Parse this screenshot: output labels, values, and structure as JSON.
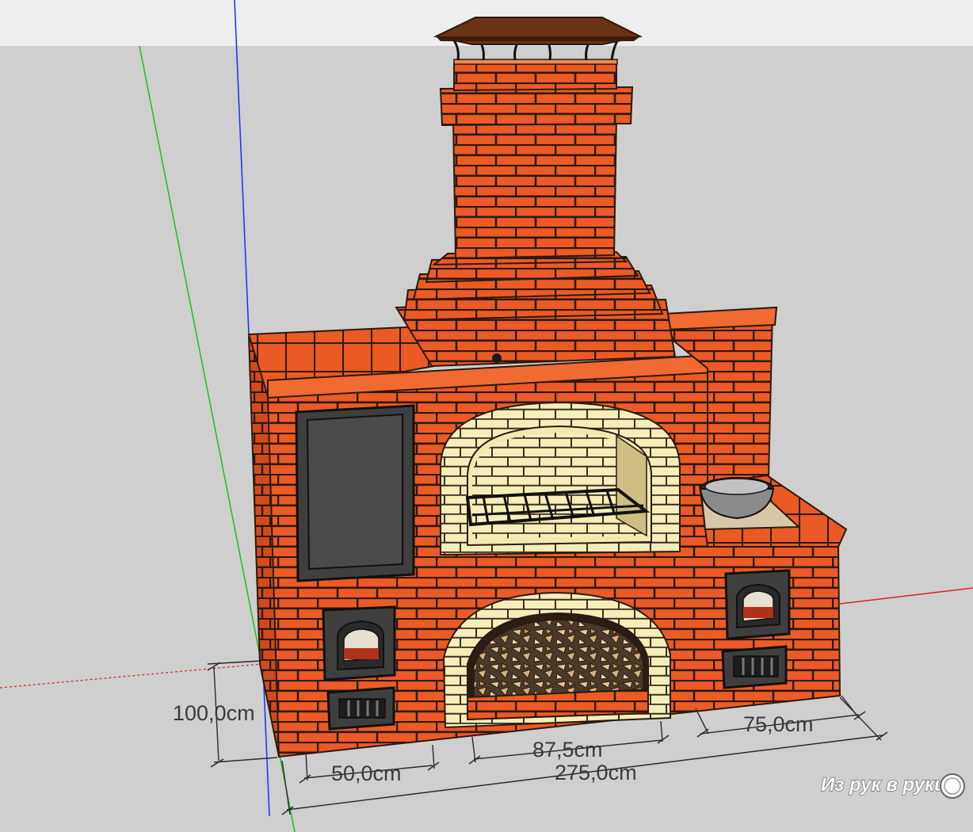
{
  "dimensions": {
    "height": "100,0cm",
    "left_section": "50,0cm",
    "middle_section": "87,5cm",
    "right_section": "75,0cm",
    "total_width": "275,0cm"
  },
  "watermark": {
    "text": "Из рук в руки"
  },
  "colors": {
    "sky": "#eeeeee",
    "ground": "#cfcfcf",
    "brick": "#ec5a26",
    "brick_dark": "#c94418",
    "cream_brick": "#f6eeb8",
    "mortar": "#2a1a10",
    "roof": "#6b3316",
    "door": "#3f3f3f",
    "axis_blue": "#1a2cff",
    "axis_green": "#1fbf1f",
    "axis_red": "#e02020"
  },
  "icons": [
    "chimney-cap-icon",
    "grill-grate-icon",
    "cauldron-icon",
    "firewood-icon",
    "oven-door-icon",
    "ash-vent-icon"
  ]
}
